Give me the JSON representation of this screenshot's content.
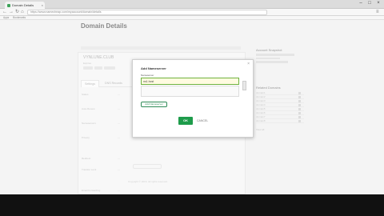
{
  "browser": {
    "tab_title": "Domain Details",
    "tab_close": "×",
    "window_controls": [
      "–",
      "□",
      "×"
    ],
    "nav": {
      "back": "←",
      "forward": "→",
      "reload": "↻",
      "home": "⌂",
      "menu": "≡"
    },
    "url": "https://www.namecheap.com/myaccount/domain/details",
    "bookmarks": [
      "Apps",
      "Bookmarks"
    ]
  },
  "page": {
    "title": "Domain Details",
    "domain_name": "VYNLUNE.CLUB",
    "sub_text": "Expires",
    "tabs": [
      {
        "label": "Settings"
      },
      {
        "label": "DNS Records"
      }
    ],
    "rows": [
      {
        "label": "Status",
        "value": "—"
      },
      {
        "label": "Auto-Renew",
        "value": "—"
      },
      {
        "label": "Nameservers",
        "value": "—"
      },
      {
        "label": "Privacy",
        "value": "—"
      },
      {
        "label": "Redirect",
        "value": "—"
      },
      {
        "label": "Transfer Lock",
        "value": "—"
      },
      {
        "label": "Email Forwarding",
        "value": "—"
      }
    ],
    "footer": "Copyright © 2016. All rights reserved."
  },
  "sidebar": {
    "section1_title": "Account Snapshot",
    "section2_title": "Related Domains",
    "items": [
      "domain1",
      "domain2",
      "domain3",
      "domain4",
      "domain5",
      "domain6",
      "domain7",
      "domain8"
    ],
    "more": "View all"
  },
  "modal": {
    "title": "Add Nameserver",
    "close": "×",
    "field_label": "Nameserver",
    "input_value": "ns1.host",
    "add_button": "Add Nameserver",
    "ok_button": "OK",
    "cancel": "CANCEL"
  },
  "colors": {
    "accent": "#1e9c4b",
    "input_focus": "#6fb23f"
  }
}
